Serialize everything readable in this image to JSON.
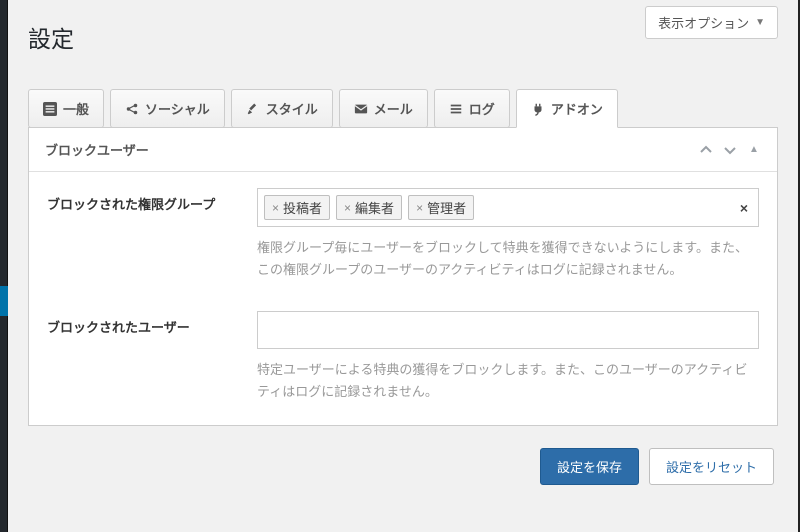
{
  "screen_options_label": "表示オプション",
  "page_title": "設定",
  "tabs": [
    {
      "label": "一般"
    },
    {
      "label": "ソーシャル"
    },
    {
      "label": "スタイル"
    },
    {
      "label": "メール"
    },
    {
      "label": "ログ"
    },
    {
      "label": "アドオン"
    }
  ],
  "panel": {
    "title": "ブロックユーザー",
    "fields": {
      "blocked_roles": {
        "label": "ブロックされた権限グループ",
        "tokens": [
          "投稿者",
          "編集者",
          "管理者"
        ],
        "help": "権限グループ毎にユーザーをブロックして特典を獲得できないようにします。また、この権限グループのユーザーのアクティビティはログに記録されません。"
      },
      "blocked_users": {
        "label": "ブロックされたユーザー",
        "value": "",
        "help": "特定ユーザーによる特典の獲得をブロックします。また、このユーザーのアクティビティはログに記録されません。"
      }
    }
  },
  "buttons": {
    "save": "設定を保存",
    "reset": "設定をリセット"
  }
}
